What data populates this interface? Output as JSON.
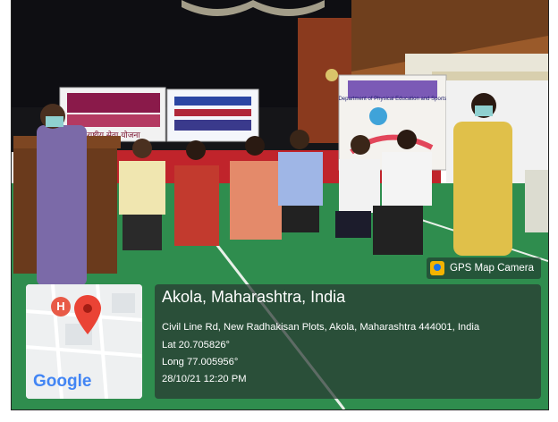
{
  "overlay": {
    "app_name": "GPS Map Camera",
    "location_title": "Akola, Maharashtra, India",
    "address": "Civil Line Rd, New Radhakisan Plots, Akola, Maharashtra 444001, India",
    "latitude": "Lat 20.705826°",
    "longitude": "Long 77.005956°",
    "datetime": "28/10/21 12:20 PM",
    "map_logo": "Google",
    "map_marker_letter": "H"
  },
  "banners": {
    "left_main_heading": "राष्ट्रीय सेवा योजना",
    "right_heading": "Department of Physical Education and Sports"
  },
  "icons": [
    "map-pin-icon",
    "hospital-marker-icon",
    "gps-camera-icon"
  ],
  "colors": {
    "floor_green": "#2f8d4e",
    "stage_red": "#c0242b",
    "panel_overlay": "#283832",
    "google_blue": "#4285f4",
    "google_red": "#ea4335",
    "google_yellow": "#fbbc05",
    "google_green": "#34a853"
  }
}
